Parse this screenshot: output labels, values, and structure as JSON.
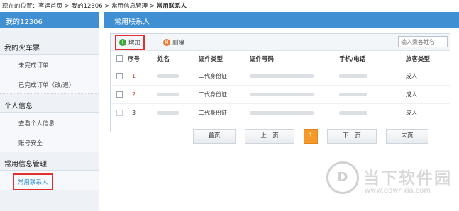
{
  "breadcrumb": {
    "prefix": "现在的位置：",
    "items": [
      "客运首页",
      "我的12306",
      "常用信息管理",
      "常用联系人"
    ],
    "separator": ">"
  },
  "sidebar": {
    "title": "我的12306",
    "sections": [
      {
        "label": "我的火车票",
        "items": [
          "未完成订单",
          "已完成订单（改/退）"
        ]
      },
      {
        "label": "个人信息",
        "items": [
          "查看个人信息",
          "账号安全"
        ]
      },
      {
        "label": "常用信息管理",
        "items": [
          "常用联系人"
        ]
      }
    ],
    "active_item": "常用联系人"
  },
  "main": {
    "title": "常用联系人",
    "toolbar": {
      "add_label": "增加",
      "delete_label": "删除",
      "search_placeholder": "输入乘客姓名"
    },
    "table": {
      "headers": [
        "序号",
        "姓名",
        "证件类型",
        "证件号码",
        "手机/电话",
        "旅客类型"
      ],
      "rows": [
        {
          "num": "1",
          "id_type": "二代身份证",
          "passenger_type": "成人"
        },
        {
          "num": "2",
          "id_type": "二代身份证",
          "passenger_type": "成人"
        },
        {
          "num": "3",
          "id_type": "二代身份证",
          "passenger_type": "成人"
        }
      ]
    },
    "pager": {
      "first": "首页",
      "prev": "上一页",
      "current": "1",
      "next": "下一页",
      "last": "末页"
    }
  },
  "watermark": {
    "text": "当下软件园",
    "url": "www.downxia.com"
  },
  "colors": {
    "header_blue": "#3f8fd2",
    "highlight_red": "#e03030",
    "current_page": "#f59a2a",
    "add_green": "#3da63d",
    "delete_orange": "#e8762d"
  }
}
